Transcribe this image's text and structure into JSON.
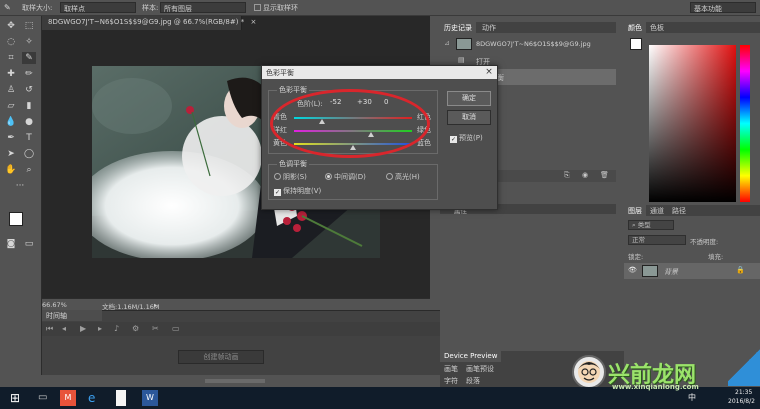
{
  "options_bar": {
    "sample_size_label": "取样大小:",
    "sample_size_value": "取样点",
    "sample_label": "样本:",
    "sample_value": "所有图层",
    "show_ring_label": "显示取样环",
    "workspace": "基本功能"
  },
  "document": {
    "tab_title": "8DGWGO7J'T~N6$O1S$$9@G9.jpg @ 66.7%(RGB/8#) *",
    "zoom": "66.67%",
    "doc_size": "文档:1.16M/1.16M"
  },
  "timeline": {
    "title": "时间轴",
    "create_button": "创建帧动画"
  },
  "history": {
    "tabs": [
      "历史记录",
      "动作"
    ],
    "snapshot_name": "8DGWGO7J'T~N6$O1S$$9@G9.jpg",
    "items": [
      "打开",
      "色彩平衡"
    ],
    "partial_label": "属性"
  },
  "color_panel": {
    "tabs": [
      "颜色",
      "色板"
    ]
  },
  "layers_panel": {
    "tabs": [
      "图层",
      "通道",
      "路径"
    ],
    "kind_placeholder": "类型",
    "blend_mode": "正常",
    "opacity_label": "不透明度:",
    "lock_label": "锁定:",
    "fill_label": "填充:",
    "layer_name": "背景"
  },
  "device_preview": {
    "title": "Device Preview",
    "tabs": [
      "画笔",
      "画笔预设",
      "字符",
      "段落"
    ]
  },
  "dialog": {
    "title": "色彩平衡",
    "color_balance_group": "色彩平衡",
    "levels_label": "色阶(L):",
    "levels": [
      "-52",
      "+30",
      "0"
    ],
    "sliders": [
      {
        "left": "青色",
        "right": "红色",
        "value": -52,
        "color_from": "#00d8e0",
        "color_to": "#e02020"
      },
      {
        "left": "洋红",
        "right": "绿色",
        "value": 30,
        "color_from": "#e020e0",
        "color_to": "#20d020"
      },
      {
        "left": "黄色",
        "right": "蓝色",
        "value": 0,
        "color_from": "#e0e020",
        "color_to": "#2050e0"
      }
    ],
    "tone_group": "色调平衡",
    "tones": [
      "阴影(S)",
      "中间调(D)",
      "高光(H)"
    ],
    "selected_tone": "中间调(D)",
    "preserve_luminosity": "保持明度(V)",
    "ok_button": "确定",
    "cancel_button": "取消",
    "preview_label": "预览(P)"
  },
  "taskbar": {
    "time": "21:35",
    "date": "2016/8/2",
    "ime": "中"
  },
  "watermark": {
    "text": "兴前龙网",
    "url": "www.xinqianlong.com"
  },
  "colors": {
    "panel_bg": "#535353",
    "canvas_bg": "#282828",
    "annotation_red": "#d9262c"
  }
}
